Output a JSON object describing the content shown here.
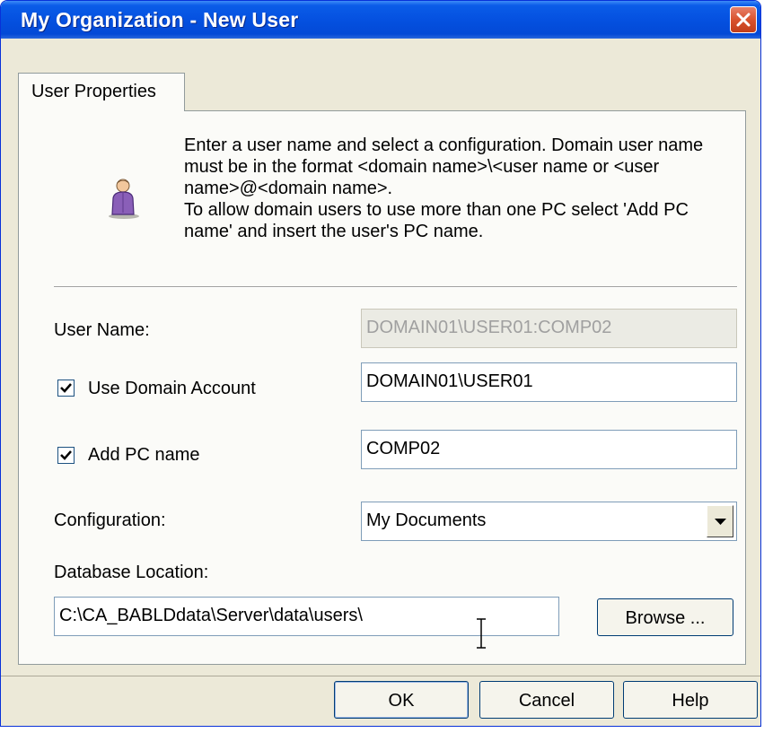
{
  "window": {
    "title": "My Organization - New User"
  },
  "tabs": [
    {
      "label": "User Properties"
    }
  ],
  "description": "Enter a user name and select a configuration. Domain user name\nmust be in the format <domain name>\\<user name or <user\nname>@<domain name>.\nTo allow domain users to use more than one PC select 'Add PC\nname' and insert the user's PC name.",
  "form": {
    "user_name_label": "User Name:",
    "user_name_value": "DOMAIN01\\USER01:COMP02",
    "use_domain_account_label": "Use Domain Account",
    "use_domain_account_checked": true,
    "domain_account_value": "DOMAIN01\\USER01",
    "add_pc_name_label": "Add PC name",
    "add_pc_name_checked": true,
    "pc_name_value": "COMP02",
    "configuration_label": "Configuration:",
    "configuration_value": "My Documents",
    "database_location_label": "Database Location:",
    "database_location_value": "C:\\CA_BABLDdata\\Server\\data\\users\\"
  },
  "buttons": {
    "browse": "Browse ...",
    "ok": "OK",
    "cancel": "Cancel",
    "help": "Help"
  },
  "icons": {
    "close": "close-icon",
    "user": "user-icon",
    "check": "checkmark-icon",
    "dropdown": "chevron-down-icon",
    "cursor": "text-cursor-icon"
  },
  "colors": {
    "title_bar": "#0551e0",
    "close_button": "#d9532e",
    "dialog_background": "#ece9d8"
  }
}
